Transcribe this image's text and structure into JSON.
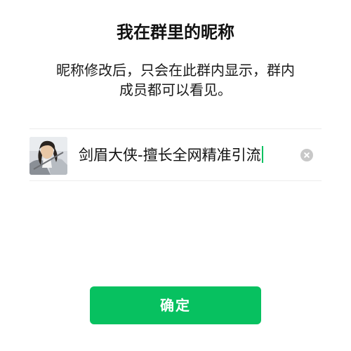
{
  "header": {
    "title": "我在群里的昵称"
  },
  "description": {
    "line1": "昵称修改后，只会在此群内显示，群内",
    "line2": "成员都可以看见。"
  },
  "nickname": {
    "value": "剑眉大侠-擅长全网精准引流"
  },
  "actions": {
    "confirm_label": "确定"
  },
  "colors": {
    "accent": "#07c160",
    "clear_icon": "#c8c8c8"
  },
  "icons": {
    "clear": "clear-icon",
    "avatar": "avatar"
  }
}
